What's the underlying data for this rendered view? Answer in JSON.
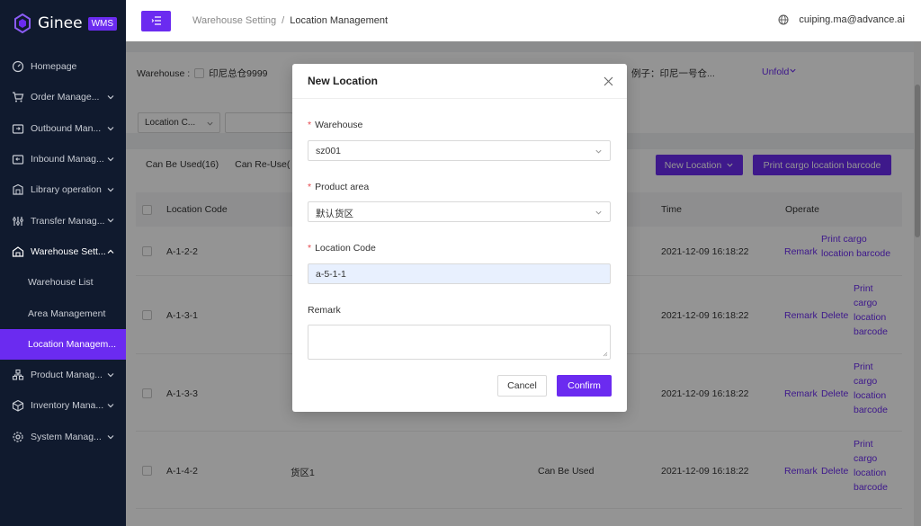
{
  "brand": {
    "name": "Ginee",
    "badge": "WMS"
  },
  "sidebar": {
    "items": [
      {
        "label": "Homepage",
        "icon": "gauge-icon",
        "has_children": false
      },
      {
        "label": "Order Manage...",
        "icon": "cart-icon",
        "has_children": true
      },
      {
        "label": "Outbound Man...",
        "icon": "outbound-icon",
        "has_children": true
      },
      {
        "label": "Inbound Manag...",
        "icon": "inbound-icon",
        "has_children": true
      },
      {
        "label": "Library operation",
        "icon": "library-icon",
        "has_children": true
      },
      {
        "label": "Transfer Manag...",
        "icon": "transfer-icon",
        "has_children": true
      },
      {
        "label": "Warehouse Sett...",
        "icon": "warehouse-icon",
        "has_children": true,
        "open": true
      }
    ],
    "sub_items": [
      {
        "label": "Warehouse List"
      },
      {
        "label": "Area Management"
      },
      {
        "label": "Location Managem...",
        "active": true
      }
    ],
    "items_after": [
      {
        "label": "Product Manag...",
        "icon": "product-icon"
      },
      {
        "label": "Inventory Mana...",
        "icon": "inventory-icon"
      },
      {
        "label": "System Manag...",
        "icon": "gear-icon"
      }
    ]
  },
  "header": {
    "breadcrumb": [
      "Warehouse Setting",
      "Location Management"
    ],
    "separator": "/",
    "user": "cuiping.ma@advance.ai"
  },
  "filter": {
    "warehouse_label": "Warehouse :",
    "warehouse_option": "印尼总仓9999",
    "right_text": "例子：印尼一号仓...",
    "unfold": "Unfold",
    "select_label": "Location C..."
  },
  "table": {
    "tabs": [
      "Can Be Used(16)",
      "Can Re-Use("
    ],
    "new_location": "New Location",
    "print_barcode": "Print cargo location barcode",
    "headers": {
      "code": "Location Code",
      "time": "Time",
      "operate": "Operate"
    },
    "rows": [
      {
        "code": "A-1-2-2",
        "area": "",
        "status": "",
        "time": "2021-12-09 16:18:22",
        "remark": "Remark",
        "delete": "",
        "print": [
          "Print cargo",
          "location barcode"
        ]
      },
      {
        "code": "A-1-3-1",
        "area": "",
        "status": "",
        "time": "2021-12-09 16:18:22",
        "remark": "Remark",
        "delete": "Delete",
        "print": [
          "Print",
          "cargo",
          "location",
          "barcode"
        ]
      },
      {
        "code": "A-1-3-3",
        "area": "",
        "status": "",
        "time": "2021-12-09 16:18:22",
        "remark": "Remark",
        "delete": "Delete",
        "print": [
          "Print",
          "cargo",
          "location",
          "barcode"
        ]
      },
      {
        "code": "A-1-4-2",
        "area": "货区1",
        "status": "Can Be Used",
        "time": "2021-12-09 16:18:22",
        "remark": "Remark",
        "delete": "Delete",
        "print": [
          "Print",
          "cargo",
          "location",
          "barcode"
        ]
      }
    ]
  },
  "modal": {
    "title": "New Location",
    "warehouse_label": "Warehouse",
    "warehouse_value": "sz001",
    "area_label": "Product area",
    "area_value": "默认货区",
    "code_label": "Location Code",
    "code_value": "a-5-1-1",
    "remark_label": "Remark",
    "cancel": "Cancel",
    "confirm": "Confirm",
    "required_mark": "*"
  },
  "colors": {
    "accent": "#6b2bf0",
    "sidebar_bg": "#101a2e",
    "required": "#e5484d"
  }
}
